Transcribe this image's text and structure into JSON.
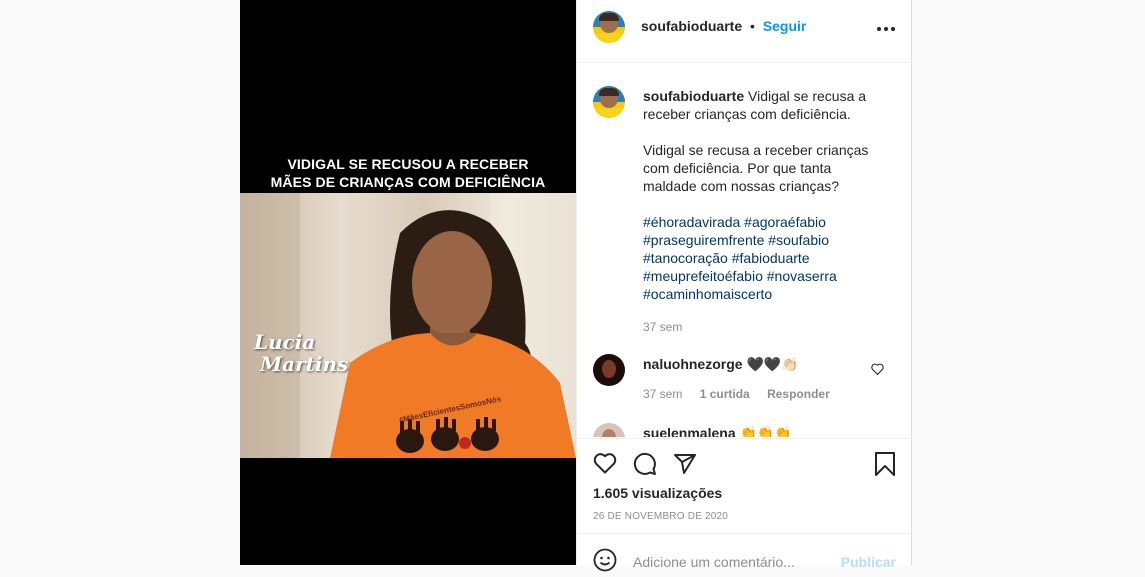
{
  "media": {
    "headline_line1": "VIDIGAL SE RECUSOU A RECEBER",
    "headline_line2": "MÃES DE CRIANÇAS COM DEFICIÊNCIA",
    "overlay_name_line1": "Lucia",
    "overlay_name_line2": "Martins",
    "shirt_text": "#MãesEficientesSomosNós"
  },
  "header": {
    "username": "soufabioduarte",
    "separator": "•",
    "follow_label": "Seguir"
  },
  "caption": {
    "username": "soufabioduarte",
    "text1": "Vidigal se recusa a receber crianças com deficiência.",
    "text2": "Vidigal se recusa a receber crianças com deficiência. Por que tanta maldade com nossas crianças?",
    "hashtags": [
      "#éhoradavirada #agoraéfabio",
      "#praseguiremfrente #soufabio",
      "#tanocoração #fabioduarte",
      "#meuprefeitoéfabio #novaserra",
      "#ocaminhomaiscerto"
    ],
    "time": "37 sem"
  },
  "comments": [
    {
      "username": "naluohnezorge",
      "text": "🖤🖤👏🏻",
      "time": "37 sem",
      "likes": "1 curtida",
      "reply_label": "Responder"
    },
    {
      "username": "suelenmalena",
      "text": "👏👏👏"
    }
  ],
  "stats": {
    "views": "1.605 visualizações",
    "date": "26 DE NOVEMBRO DE 2020"
  },
  "add_comment": {
    "placeholder": "Adicione um comentário...",
    "publish_label": "Publicar"
  },
  "colors": {
    "link_blue": "#0095f6",
    "hashtag": "#00376b",
    "muted": "#8e8e8e",
    "shirt_orange": "#f07a26"
  }
}
